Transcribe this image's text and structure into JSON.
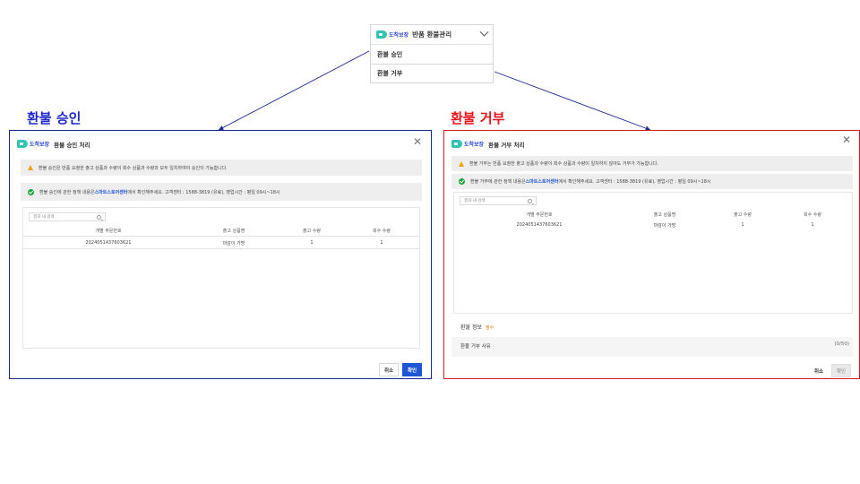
{
  "logo": {
    "text": "도착보장"
  },
  "dropdown": {
    "title": "반품 환불관리",
    "items": [
      "환불 승인",
      "환불 거부"
    ]
  },
  "headings": {
    "approve": "환불 승인",
    "reject": "환불 거부"
  },
  "approve_dialog": {
    "title": "환불 승인 처리",
    "notice_warning": "환불 승인은 반품 요청한 출고 상품과 수량이 회수 상품과 수량과 모두 일치하여야 승인이 가능합니다.",
    "notice_info_prefix": "환불 승인에 관한 정책 내용은 ",
    "notice_info_link": "스마트스토어센터",
    "notice_info_suffix": "에서 확인해주세요. 고객센터 : 1588-3819 (유료), 영업시간 : 평일 09시~18시",
    "search_placeholder": "결과 내 검색",
    "columns": [
      "개별 주문번호",
      "출고 상품명",
      "출고 수량",
      "회수 수량"
    ],
    "rows": [
      [
        "2024051437603621",
        "마감이 가방",
        "1",
        "1"
      ]
    ],
    "cancel_label": "취소",
    "confirm_label": "확인"
  },
  "reject_dialog": {
    "title": "환불 거부 처리",
    "notice_warning": "환불 거부는 반품 요청한 출고 상품과 수량이 회수 상품과 수량이 일치하지 않아도 거부가 가능합니다.",
    "notice_info_prefix": "환불 거부에 관한 정책 내용은 ",
    "notice_info_link": "스마트스토어센터",
    "notice_info_suffix": "에서 확인해주세요. 고객센터 : 1588-3819 (유료), 영업시간 : 평일 09시~18시",
    "search_placeholder": "결과 내 검색",
    "columns": [
      "개별 주문번호",
      "출고 상품명",
      "출고 수량",
      "회수 수량"
    ],
    "rows": [
      [
        "2024051437603621",
        "마감이 가방",
        "1",
        "1"
      ]
    ],
    "refund_info_label": "환불 정보",
    "required_label": "필수",
    "reason_label": "환불 거부 사유",
    "reason_counter": "(0/50)",
    "cancel_label": "취소",
    "confirm_label": "확인"
  },
  "colors": {
    "approve_accent": "#1d28c9",
    "reject_accent": "#e8141b",
    "primary_button": "#1e57d6",
    "logo_mark": "#33c3b4"
  },
  "icons": [
    "chevron-down-icon",
    "close-icon",
    "warning-icon",
    "check-circle-icon",
    "search-icon",
    "arrow-icon"
  ]
}
